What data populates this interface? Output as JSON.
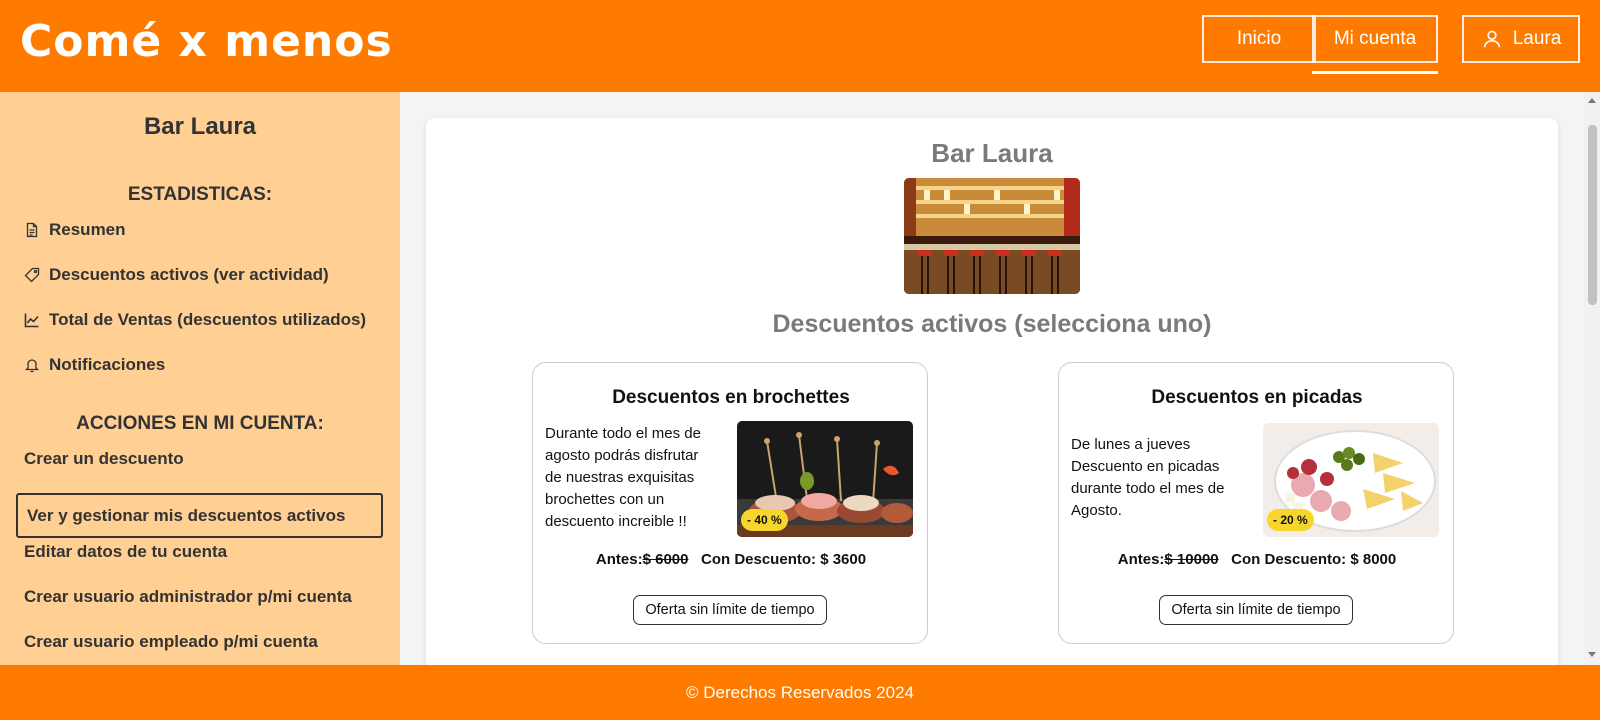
{
  "header": {
    "logo": "Comé x menos",
    "nav": {
      "inicio": "Inicio",
      "mi_cuenta": "Mi cuenta",
      "user": "Laura"
    }
  },
  "sidebar": {
    "title": "Bar Laura",
    "stats_heading": "ESTADISTICAS:",
    "stats_items": [
      {
        "label": "Resumen",
        "icon": "document-icon"
      },
      {
        "label": "Descuentos activos (ver actividad)",
        "icon": "tag-icon"
      },
      {
        "label": "Total de Ventas (descuentos utilizados)",
        "icon": "chart-line-icon"
      },
      {
        "label": "Notificaciones",
        "icon": "bell-icon"
      }
    ],
    "actions_heading": "ACCIONES EN MI CUENTA:",
    "actions": [
      "Crear un descuento",
      "Ver y gestionar mis descuentos activos",
      "Editar datos de tu cuenta",
      "Crear usuario administrador p/mi cuenta",
      "Crear usuario empleado p/mi cuenta"
    ]
  },
  "main": {
    "title": "Bar Laura",
    "subtitle": "Descuentos activos (selecciona uno)",
    "cards": [
      {
        "title": "Descuentos en brochettes",
        "description": "Durante todo el mes de agosto podrás disfrutar de nuestras exquisitas brochettes con un descuento increible !!",
        "badge": "- 40 %",
        "before_label": "Antes:",
        "before_price": "$ 6000",
        "after_label": "Con Descuento:",
        "after_price": "$ 3600",
        "button": "Oferta sin límite de tiempo"
      },
      {
        "title": "Descuentos en picadas",
        "description": "De lunes a jueves Descuento en picadas durante todo el mes de Agosto.",
        "badge": "- 20 %",
        "before_label": "Antes:",
        "before_price": "$ 10000",
        "after_label": "Con Descuento:",
        "after_price": "$ 8000",
        "button": "Oferta sin límite de tiempo"
      }
    ]
  },
  "footer": {
    "text": "© Derechos Reservados 2024"
  },
  "colors": {
    "brand": "#ff7b00",
    "sidebar": "#ffcf94",
    "badge": "#f7d52b"
  }
}
